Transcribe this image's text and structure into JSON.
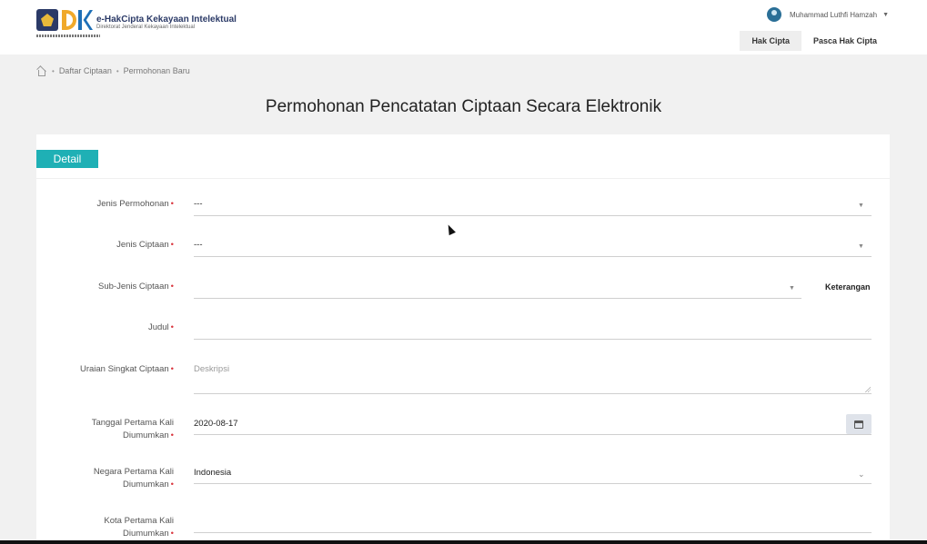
{
  "header": {
    "logo_title": "e-HakCipta Kekayaan Intelektual",
    "logo_subtitle": "Direktorat Jenderal Kekayaan Intelektual",
    "user_name": "Muhammad Luthfi Hamzah",
    "nav": [
      {
        "label": "Hak Cipta",
        "active": true
      },
      {
        "label": "Pasca Hak Cipta",
        "active": false
      }
    ]
  },
  "breadcrumb": [
    "Daftar Ciptaan",
    "Permohonan Baru"
  ],
  "page_title": "Permohonan Pencatatan Ciptaan Secara Elektronik",
  "tab_label": "Detail",
  "accent_color": "#1fb0b5",
  "required_color": "#d9363e",
  "form": {
    "jenis_permohonan": {
      "label": "Jenis Permohonan",
      "value": "---"
    },
    "jenis_ciptaan": {
      "label": "Jenis Ciptaan",
      "value": "---"
    },
    "sub_jenis": {
      "label": "Sub-Jenis Ciptaan",
      "value": "",
      "side_label": "Keterangan"
    },
    "judul": {
      "label": "Judul",
      "value": ""
    },
    "uraian": {
      "label": "Uraian Singkat Ciptaan",
      "placeholder": "Deskripsi"
    },
    "tanggal": {
      "label_line1": "Tanggal Pertama Kali",
      "label_line2": "Diumumkan",
      "value": "2020-08-17"
    },
    "negara": {
      "label_line1": "Negara Pertama Kali",
      "label_line2": "Diumumkan",
      "value": "Indonesia"
    },
    "kota": {
      "label_line1": "Kota Pertama Kali",
      "label_line2": "Diumumkan",
      "value": ""
    }
  },
  "icons": {
    "home": "home-icon",
    "calendar": "calendar-icon",
    "caret": "chevron-down-icon"
  }
}
